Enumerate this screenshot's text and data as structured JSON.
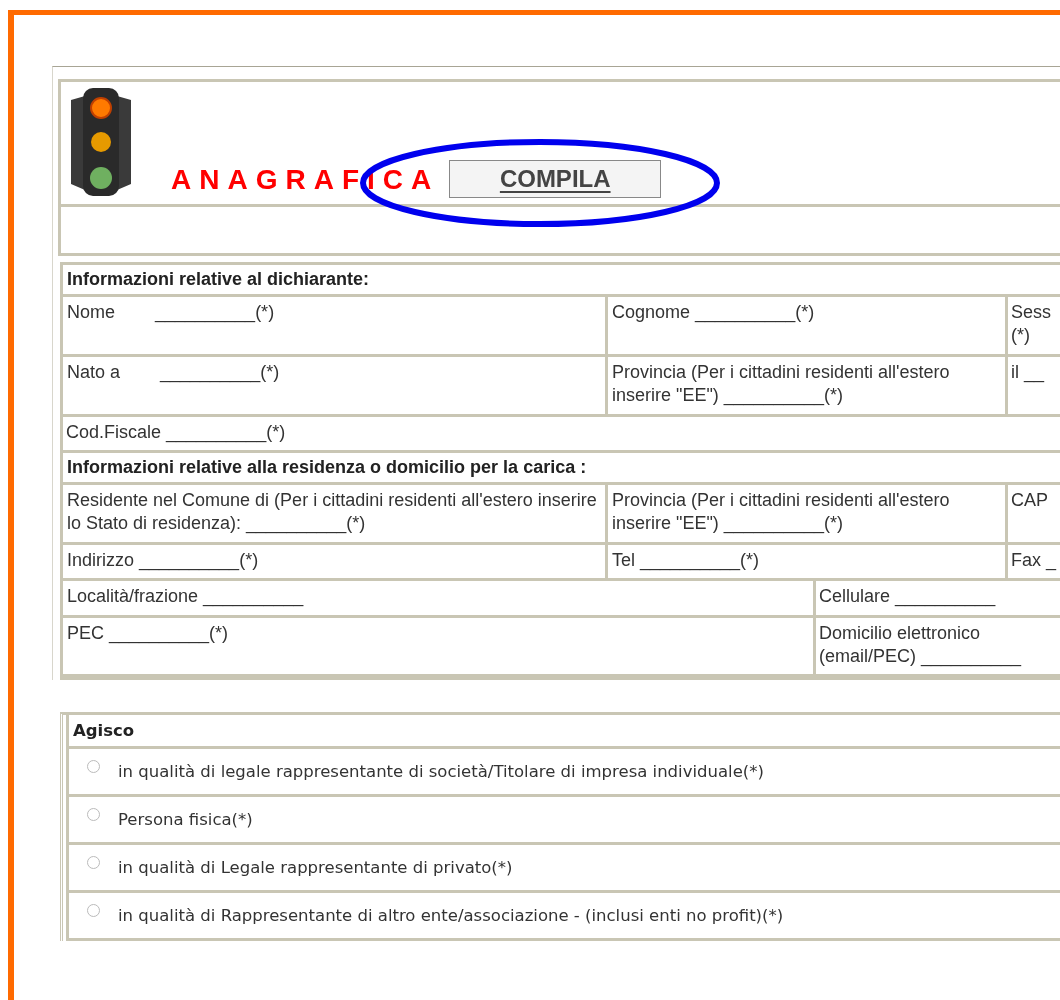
{
  "header": {
    "title": "ANAGRAFICA",
    "button": "COMPILA"
  },
  "sections": [
    {
      "title": "Informazioni relative al dichiarante:",
      "rows": [
        {
          "kind": "three",
          "cells": [
            "Nome        __________(*)",
            "Cognome __________(*)",
            "Sess (*)"
          ]
        },
        {
          "kind": "three",
          "cells": [
            "Nato a        __________(*)",
            "Provincia (Per i cittadini residenti all'estero inserire \"EE\") __________(*)",
            "il __"
          ]
        },
        {
          "kind": "full",
          "cells": [
            "Cod.Fiscale __________(*)"
          ]
        }
      ]
    },
    {
      "title": "Informazioni relative alla residenza o domicilio per la carica :",
      "rows": [
        {
          "kind": "three",
          "cells": [
            "Residente nel Comune di (Per i cittadini residenti all'estero inserire lo Stato di residenza): __________(*)",
            "Provincia (Per i cittadini residenti all'estero inserire \"EE\") __________(*)",
            "CAP"
          ]
        },
        {
          "kind": "three",
          "cells": [
            "Indirizzo __________(*)",
            "Tel __________(*)",
            "Fax _"
          ]
        },
        {
          "kind": "two",
          "cells": [
            "Località/frazione __________",
            "Cellulare __________"
          ]
        },
        {
          "kind": "two",
          "cells": [
            "PEC __________(*)",
            "Domicilio elettronico (email/PEC) __________"
          ]
        }
      ]
    }
  ],
  "agisco": {
    "title": "Agisco",
    "options": [
      {
        "label": "in qualità di legale rappresentante di società/Titolare di impresa individuale(*)",
        "selected": false
      },
      {
        "label": "Persona fisica(*)",
        "selected": false
      },
      {
        "label": "in qualità di Legale rappresentante di privato(*)",
        "selected": false
      },
      {
        "label": "in qualità di Rappresentante di altro ente/associazione - (inclusi enti no profit)(*)",
        "selected": false
      }
    ]
  }
}
